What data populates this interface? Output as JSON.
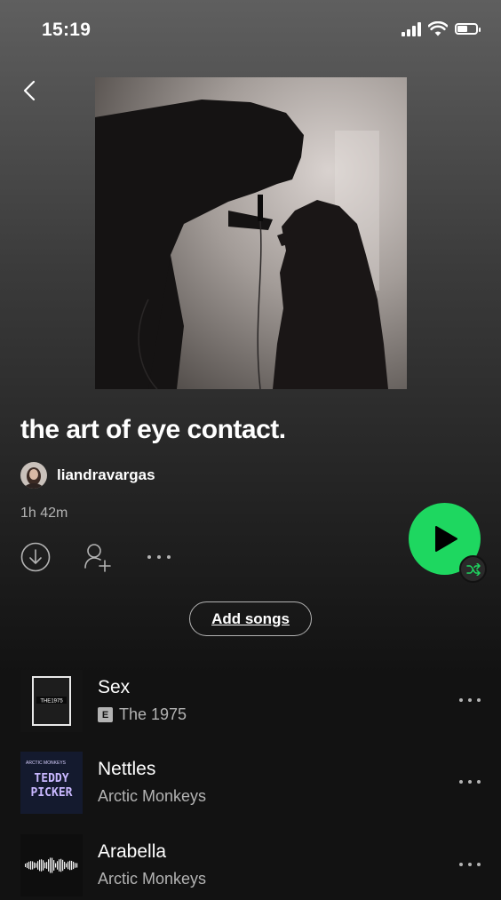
{
  "status_bar": {
    "time": "15:19",
    "battery_level": 0.55
  },
  "playlist": {
    "title": "the art of eye contact.",
    "owner": "liandravargas",
    "duration": "1h 42m",
    "add_songs_label": "Add songs"
  },
  "icons": {
    "back": "chevron-left-icon",
    "download": "download-icon",
    "follow": "add-user-icon",
    "more": "more-horizontal-icon",
    "play": "play-icon",
    "shuffle": "shuffle-icon"
  },
  "colors": {
    "accent": "#1ed760",
    "background": "#121212",
    "secondary_text": "#b3b3b3"
  },
  "tracks": [
    {
      "title": "Sex",
      "artist": "The 1975",
      "explicit": true,
      "explicit_label": "E",
      "art_text": "THE1975"
    },
    {
      "title": "Nettles",
      "artist": "Arctic Monkeys",
      "explicit": false,
      "art_text_1": "ARCTIC MONKEYS",
      "art_text_2": "TEDDY",
      "art_text_3": "PICKER"
    },
    {
      "title": "Arabella",
      "artist": "Arctic Monkeys",
      "explicit": false
    }
  ]
}
